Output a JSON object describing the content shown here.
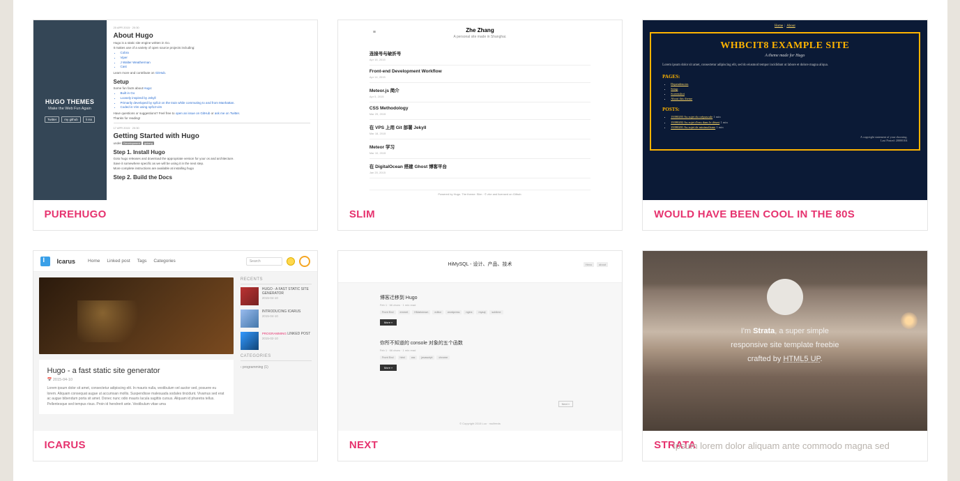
{
  "cards": [
    {
      "title": "PUREHUGO"
    },
    {
      "title": "SLIM"
    },
    {
      "title": "WOULD HAVE BEEN COOL IN THE 80S"
    },
    {
      "title": "ICARUS"
    },
    {
      "title": "NEXT"
    },
    {
      "title": "STRATA"
    }
  ],
  "purehugo": {
    "side_title": "HUGO THEMES",
    "side_sub": "Make the Web Fun Again",
    "side_buttons": [
      "Twitter",
      "my github",
      "li rss"
    ],
    "date1": "20 APR 2015 · 20:30",
    "h1": "About Hugo",
    "intro": "Hugo is a static site engine written in Go.",
    "uses": "It makes use of a variety of open source projects including:",
    "libs": [
      "Cobra",
      "Viper",
      "J Walter Weatherman",
      "Cast"
    ],
    "learn": "Learn more and contribute on",
    "gh": "GitHub",
    "setup": "Setup",
    "facts": "Some fun facts about",
    "hugo": "Hugo",
    "bullets": [
      "Built in Go",
      "Loosely inspired by Jekyll",
      "Primarily developed by spf13 on the train while commuting to and from Manhattan.",
      "Coded in Vim using spf13-vim"
    ],
    "questions": "Have questions or suggestions? Feel free to",
    "issue": "open an issue on GitHub",
    "or": "or",
    "twitter": "ask me on Twitter",
    "thanks": "Thanks for reading!",
    "date2": "17 APR 2015 · 20:30",
    "h2": "Getting Started with Hugo",
    "tag_under": "under",
    "tag_dev": "Development",
    "tag_go": "golang",
    "step1": "Step 1. Install Hugo",
    "step1_body": "Goto hugo releases and download the appropriate version for your os and architecture.",
    "step1_body2": "Save it somewhere specific as we will be using it in the next step.",
    "step1_body3": "More complete instructions are available at installing hugo",
    "step2": "Step 2. Build the Docs"
  },
  "slim": {
    "burger": "≡",
    "name": "Zhe Zhang",
    "sub": "A personal site made in Shanghai.",
    "items": [
      {
        "t": "连接号与破折号",
        "d": "Apr 16, 2015"
      },
      {
        "t": "Front-end Development Workflow",
        "d": "Apr 14, 2015"
      },
      {
        "t": "Meteor.js 简介",
        "d": "Apr 5, 2015"
      },
      {
        "t": "CSS Methodology",
        "d": "Mar 29, 2015"
      },
      {
        "t": "在 VPS 上用 Git 部署 Jekyll",
        "d": "Mar 18, 2015"
      },
      {
        "t": "Meteor 学习",
        "d": "Mar 10, 2015"
      },
      {
        "t": "在 DigitalOcean 搭建 Ghost 博客平台",
        "d": "Jan 20, 2015"
      }
    ],
    "foot": "Powered by Hugo. The theme: Slim · © zhe and licensed on Github."
  },
  "eighties": {
    "nav_home": "Home",
    "nav_about": "About",
    "title": "WHBCIT8 EXAMPLE SITE",
    "sub": "A theme made for Hugo",
    "lorem": "Lorem ipsum dolor sit amet, consectetur adipiscing elit, sed do eiusmod tempor incididunt ut labore et dolore magna aliqua.",
    "pages": "PAGES:",
    "page_links": [
      "Dependencies",
      "Setup",
      "Screenshot",
      "About this theme"
    ],
    "posts": "POSTS:",
    "post_links": [
      {
        "t": "19390203 Au sujet du crépuscule",
        "m": "1 min"
      },
      {
        "t": "19390202 Au sujet d'eau dans le désert",
        "m": "1 min"
      },
      {
        "t": "19390201 Au sujet de minimalisme",
        "m": "1 min"
      }
    ],
    "foot1": "A copyright statement of your choosing.",
    "foot2": "Last Posted: 20000104"
  },
  "icarus": {
    "brand": "Icarus",
    "nav": [
      "Home",
      "Linked post",
      "Tags",
      "Categories"
    ],
    "search_ph": "Search",
    "post_title": "Hugo - a fast static site generator",
    "post_date": "📅 2015-04-10",
    "post_body": "Lorem ipsum dolor sit amet, consectetur adipiscing elit. In mauris nulla, vestibulum vel auctor sed, posuere eu lorem. Aliquam consequat augue ut accumsan mollis. Suspendisse malesuada sodales tincidunt. Vivamus sed erat ac augue bibendum porta sit amet. Donec nunc odio mauris lacula sagittis cursus. Aliquam id pharetra tellus. Pellentesque sed tempus risus. Proin id hendrerit ante. Vestibulum vitae uma",
    "recents": "RECENTS",
    "rec": [
      {
        "tag": "",
        "t": "HUGO - A FAST STATIC SITE GENERATOR",
        "d": "2015-04-10"
      },
      {
        "tag": "",
        "t": "INTRODUCING ICARUS",
        "d": "2015-04-10"
      },
      {
        "tag": "PROGRAMMING",
        "t": "LINKED POST",
        "d": "2015-02-10"
      }
    ],
    "cats": "CATEGORIES",
    "cat_item": "‹ programming  (1)"
  },
  "next": {
    "head_title": "HiMySQL - 设计、产品、技术",
    "head_tags": [
      "Hexo",
      "about"
    ],
    "p1_title": "博客迁移到 Hugo",
    "p1_meta": "Feb 1 · 66 chars · 1 min read",
    "p1_tags": [
      "Front End",
      "emmet",
      "HMarkdown",
      "editor",
      "wordpress",
      "nginx",
      "mysql",
      "sublime"
    ],
    "p2_title": "你所不知道的 console 对象的五个函数",
    "p2_meta": "Feb 1 · 66 chars · 1 min read",
    "p2_tags": [
      "Front End",
      "html",
      "css",
      "javascript",
      "chrome"
    ],
    "more": "More »",
    "page": "Next »",
    "foot": "© Copyright 2015 Luo · rss/feeds"
  },
  "strata": {
    "line1_pre": "I'm ",
    "line1_b": "Strata",
    "line1_post": ", a super simple",
    "line2": "responsive site template freebie",
    "line3_pre": "crafted by ",
    "line3_link": "HTML5 UP",
    "line3_post": ".",
    "ghost": "Ipsum lorem dolor aliquam ante commodo magna sed"
  }
}
